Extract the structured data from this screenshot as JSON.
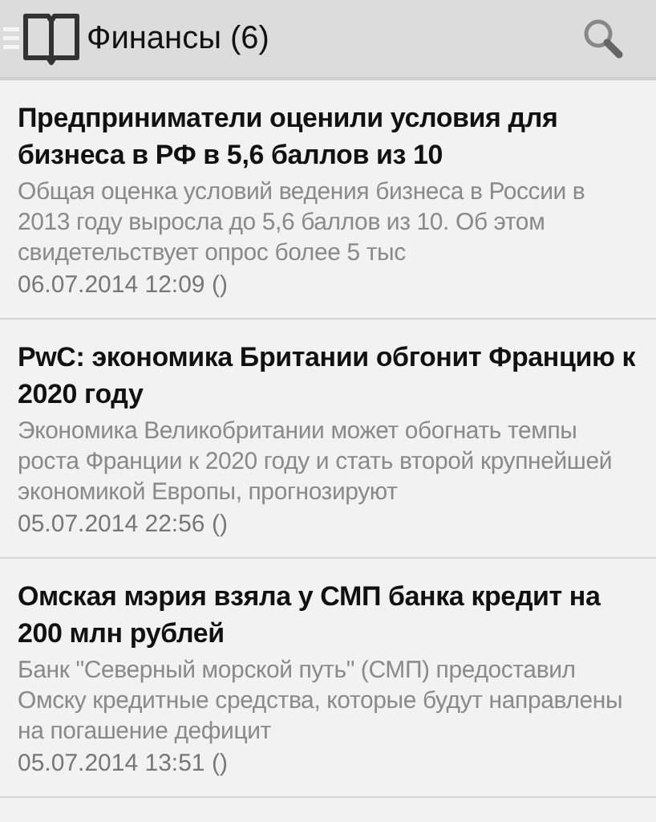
{
  "action_bar": {
    "title": "Финансы (6)"
  },
  "articles": [
    {
      "title": "Предприниматели оценили условия для бизнеса в РФ в 5,6 баллов из 10",
      "summary": "Общая оценка условий ведения бизнеса в России в 2013 году выросла до 5,6 баллов из 10. Об этом свидетельствует опрос более 5 тыс",
      "date": "06.07.2014 12:09 ()"
    },
    {
      "title": "PwC: экономика Британии обгонит Францию к 2020 году",
      "summary": "Экономика Великобритании может обогнать темпы роста Франции к 2020 году и стать второй крупнейшей экономикой Европы, прогнозируют",
      "date": "05.07.2014 22:56 ()"
    },
    {
      "title": "Омская мэрия взяла у СМП банка кредит на 200 млн рублей",
      "summary": "Банк \"Северный морской путь\" (СМП) предоставил Омску кредитные средства, которые будут направлены на погашение дефицит",
      "date": "05.07.2014 13:51 ()"
    }
  ]
}
